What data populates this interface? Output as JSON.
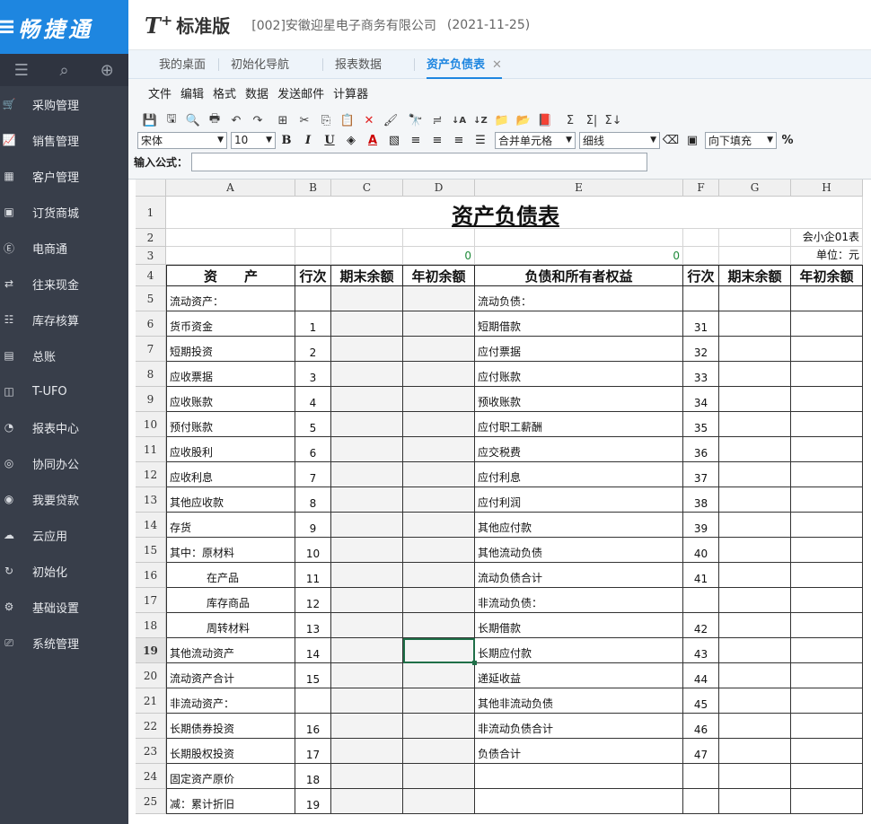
{
  "brand": {
    "mark": "≡",
    "name": "畅捷通"
  },
  "sidebar": {
    "tools": [
      {
        "icon": "menu-icon",
        "glyph": "☰"
      },
      {
        "icon": "search-doc-icon",
        "glyph": "⌕"
      },
      {
        "icon": "add-window-icon",
        "glyph": "⊕"
      }
    ],
    "items": [
      {
        "label": "采购管理",
        "icon": "cart-icon",
        "glyph": "🛒"
      },
      {
        "label": "销售管理",
        "icon": "sales-chart-icon",
        "glyph": "📈"
      },
      {
        "label": "客户管理",
        "icon": "customer-grid-icon",
        "glyph": "▦"
      },
      {
        "label": "订货商城",
        "icon": "store-icon",
        "glyph": "▣"
      },
      {
        "label": "电商通",
        "icon": "ecommerce-icon",
        "glyph": "Ⓔ"
      },
      {
        "label": "往来现金",
        "icon": "exchange-icon",
        "glyph": "⇄"
      },
      {
        "label": "库存核算",
        "icon": "warehouse-icon",
        "glyph": "☷"
      },
      {
        "label": "总账",
        "icon": "ledger-icon",
        "glyph": "▤"
      },
      {
        "label": "T-UFO",
        "icon": "ufo-icon",
        "glyph": "◫"
      },
      {
        "label": "报表中心",
        "icon": "pie-chart-icon",
        "glyph": "◔"
      },
      {
        "label": "协同办公",
        "icon": "collaborate-icon",
        "glyph": "◎"
      },
      {
        "label": "我要贷款",
        "icon": "loan-icon",
        "glyph": "◉"
      },
      {
        "label": "云应用",
        "icon": "cloud-icon",
        "glyph": "☁"
      },
      {
        "label": "初始化",
        "icon": "init-icon",
        "glyph": "↻"
      },
      {
        "label": "基础设置",
        "icon": "settings-icon",
        "glyph": "⚙"
      },
      {
        "label": "系统管理",
        "icon": "system-icon",
        "glyph": "⎚"
      }
    ]
  },
  "header": {
    "product": "T",
    "plus": "+",
    "edition": "标准版",
    "company": "[002]安徽迎星电子商务有限公司",
    "date": "(2021-11-25)"
  },
  "tabs": [
    {
      "label": "我的桌面",
      "active": false
    },
    {
      "label": "初始化导航",
      "active": false
    },
    {
      "label": "报表数据",
      "active": false
    },
    {
      "label": "资产负债表",
      "active": true,
      "close": "✕"
    }
  ],
  "menu": [
    "文件",
    "编辑",
    "格式",
    "数据",
    "发送邮件",
    "计算器"
  ],
  "toolbar": {
    "icons": [
      {
        "name": "save-icon",
        "glyph": "💾"
      },
      {
        "name": "save-as-icon",
        "glyph": "🖫"
      },
      {
        "name": "print-preview-icon",
        "glyph": "🔍"
      },
      {
        "name": "print-icon",
        "glyph": "🖶"
      },
      {
        "name": "undo-icon",
        "glyph": "↶"
      },
      {
        "name": "redo-icon",
        "glyph": "↷"
      },
      {
        "name": "select-all-icon",
        "glyph": "⊞"
      },
      {
        "name": "cut-icon",
        "glyph": "✂"
      },
      {
        "name": "copy-icon",
        "glyph": "⎘"
      },
      {
        "name": "paste-icon",
        "glyph": "📋"
      },
      {
        "name": "delete-icon",
        "glyph": "✕"
      },
      {
        "name": "format-painter-icon",
        "glyph": "🖌"
      },
      {
        "name": "find-icon",
        "glyph": "🔭"
      },
      {
        "name": "replace-icon",
        "glyph": "≓"
      },
      {
        "name": "sort-asc-icon",
        "glyph": "↓A"
      },
      {
        "name": "sort-desc-icon",
        "glyph": "↓Z"
      },
      {
        "name": "clipboard-icon",
        "glyph": "📁"
      },
      {
        "name": "paste-special-icon",
        "glyph": "📂"
      },
      {
        "name": "book-icon",
        "glyph": "📕"
      },
      {
        "name": "sum-icon",
        "glyph": "Σ"
      },
      {
        "name": "sum-row-icon",
        "glyph": "Σ|"
      },
      {
        "name": "sum-col-icon",
        "glyph": "Σ↓"
      }
    ],
    "font_family": "宋体",
    "font_size": "10",
    "bold": "B",
    "italic": "I",
    "underline": "U",
    "merge_select": "合并单元格",
    "border_select": "细线",
    "fill_select": "向下填充",
    "percent": "%",
    "formula_label": "输入公式："
  },
  "sheet": {
    "columns": [
      "A",
      "B",
      "C",
      "D",
      "E",
      "F",
      "G",
      "H"
    ],
    "title": "资产负债表",
    "form_code": "会小企01表",
    "unit": "单位：元",
    "zero_d": "0",
    "zero_e": "0",
    "headers": [
      "资　　产",
      "行次",
      "期末余额",
      "年初余额",
      "负债和所有者权益",
      "行次",
      "期末余额",
      "年初余额"
    ],
    "row_numbers": [
      "1",
      "2",
      "3",
      "4",
      "5",
      "6",
      "7",
      "8",
      "9",
      "10",
      "11",
      "12",
      "13",
      "14",
      "15",
      "16",
      "17",
      "18",
      "19",
      "20",
      "21",
      "22",
      "23",
      "24",
      "25"
    ],
    "rows": [
      {
        "a": "流动资产：",
        "b": "",
        "e": "流动负债：",
        "f": "",
        "ind": false
      },
      {
        "a": "货币资金",
        "b": "1",
        "e": "短期借款",
        "f": "31",
        "ind": false
      },
      {
        "a": "短期投资",
        "b": "2",
        "e": "应付票据",
        "f": "32",
        "ind": false
      },
      {
        "a": "应收票据",
        "b": "3",
        "e": "应付账款",
        "f": "33",
        "ind": false
      },
      {
        "a": "应收账款",
        "b": "4",
        "e": "预收账款",
        "f": "34",
        "ind": false
      },
      {
        "a": "预付账款",
        "b": "5",
        "e": "应付职工薪酬",
        "f": "35",
        "ind": false
      },
      {
        "a": "应收股利",
        "b": "6",
        "e": "应交税费",
        "f": "36",
        "ind": false
      },
      {
        "a": "应收利息",
        "b": "7",
        "e": "应付利息",
        "f": "37",
        "ind": false
      },
      {
        "a": "其他应收款",
        "b": "8",
        "e": "应付利润",
        "f": "38",
        "ind": false
      },
      {
        "a": "存货",
        "b": "9",
        "e": "其他应付款",
        "f": "39",
        "ind": false
      },
      {
        "a": "其中：原材料",
        "b": "10",
        "e": "其他流动负债",
        "f": "40",
        "ind": false
      },
      {
        "a": "在产品",
        "b": "11",
        "e": "流动负债合计",
        "f": "41",
        "ind": true
      },
      {
        "a": "库存商品",
        "b": "12",
        "e": "非流动负债：",
        "f": "",
        "ind": true
      },
      {
        "a": "周转材料",
        "b": "13",
        "e": "长期借款",
        "f": "42",
        "ind": true
      },
      {
        "a": "其他流动资产",
        "b": "14",
        "e": "长期应付款",
        "f": "43",
        "ind": false
      },
      {
        "a": "流动资产合计",
        "b": "15",
        "e": "递延收益",
        "f": "44",
        "ind": false
      },
      {
        "a": "非流动资产：",
        "b": "",
        "e": "其他非流动负债",
        "f": "45",
        "ind": false
      },
      {
        "a": "长期债券投资",
        "b": "16",
        "e": "非流动负债合计",
        "f": "46",
        "ind": false
      },
      {
        "a": "长期股权投资",
        "b": "17",
        "e": "负债合计",
        "f": "47",
        "ind": false
      },
      {
        "a": "固定资产原价",
        "b": "18",
        "e": "",
        "f": "",
        "ind": false
      },
      {
        "a": "减：累计折旧",
        "b": "19",
        "e": "",
        "f": "",
        "ind": false
      }
    ],
    "selected_row": "19",
    "selected_col": "D"
  }
}
